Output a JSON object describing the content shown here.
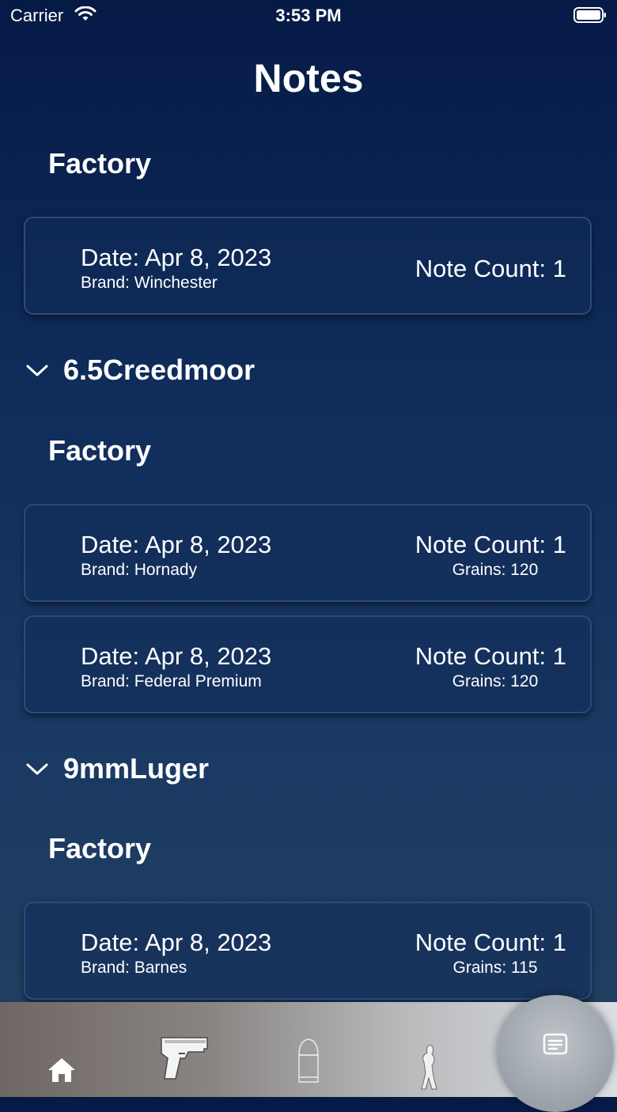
{
  "status_bar": {
    "carrier": "Carrier",
    "time": "3:53 PM"
  },
  "page": {
    "title": "Notes"
  },
  "sections": [
    {
      "group": "",
      "subheader": "Factory",
      "cards": [
        {
          "date": "Date: Apr 8, 2023",
          "brand": "Brand: Winchester",
          "count": "Note Count: 1",
          "grains": ""
        }
      ]
    },
    {
      "group": "6.5Creedmoor",
      "subheader": "Factory",
      "cards": [
        {
          "date": "Date: Apr 8, 2023",
          "brand": "Brand: Hornady",
          "count": "Note Count: 1",
          "grains": "Grains: 120"
        },
        {
          "date": "Date: Apr 8, 2023",
          "brand": "Brand: Federal Premium",
          "count": "Note Count: 1",
          "grains": "Grains: 120"
        }
      ]
    },
    {
      "group": "9mmLuger",
      "subheader": "Factory",
      "cards": [
        {
          "date": "Date: Apr 8, 2023",
          "brand": "Brand: Barnes",
          "count": "Note Count: 1",
          "grains": "Grains: 115"
        }
      ]
    }
  ],
  "tab_bar": {
    "tabs": [
      {
        "icon": "home-icon"
      },
      {
        "icon": "pistol-icon"
      },
      {
        "icon": "bullet-icon"
      },
      {
        "icon": "figure-icon"
      }
    ],
    "active_icon": "notes-icon"
  },
  "colors": {
    "card_border": "#2b4b7c",
    "background_top": "#061a46",
    "background_bottom": "#22405f"
  }
}
